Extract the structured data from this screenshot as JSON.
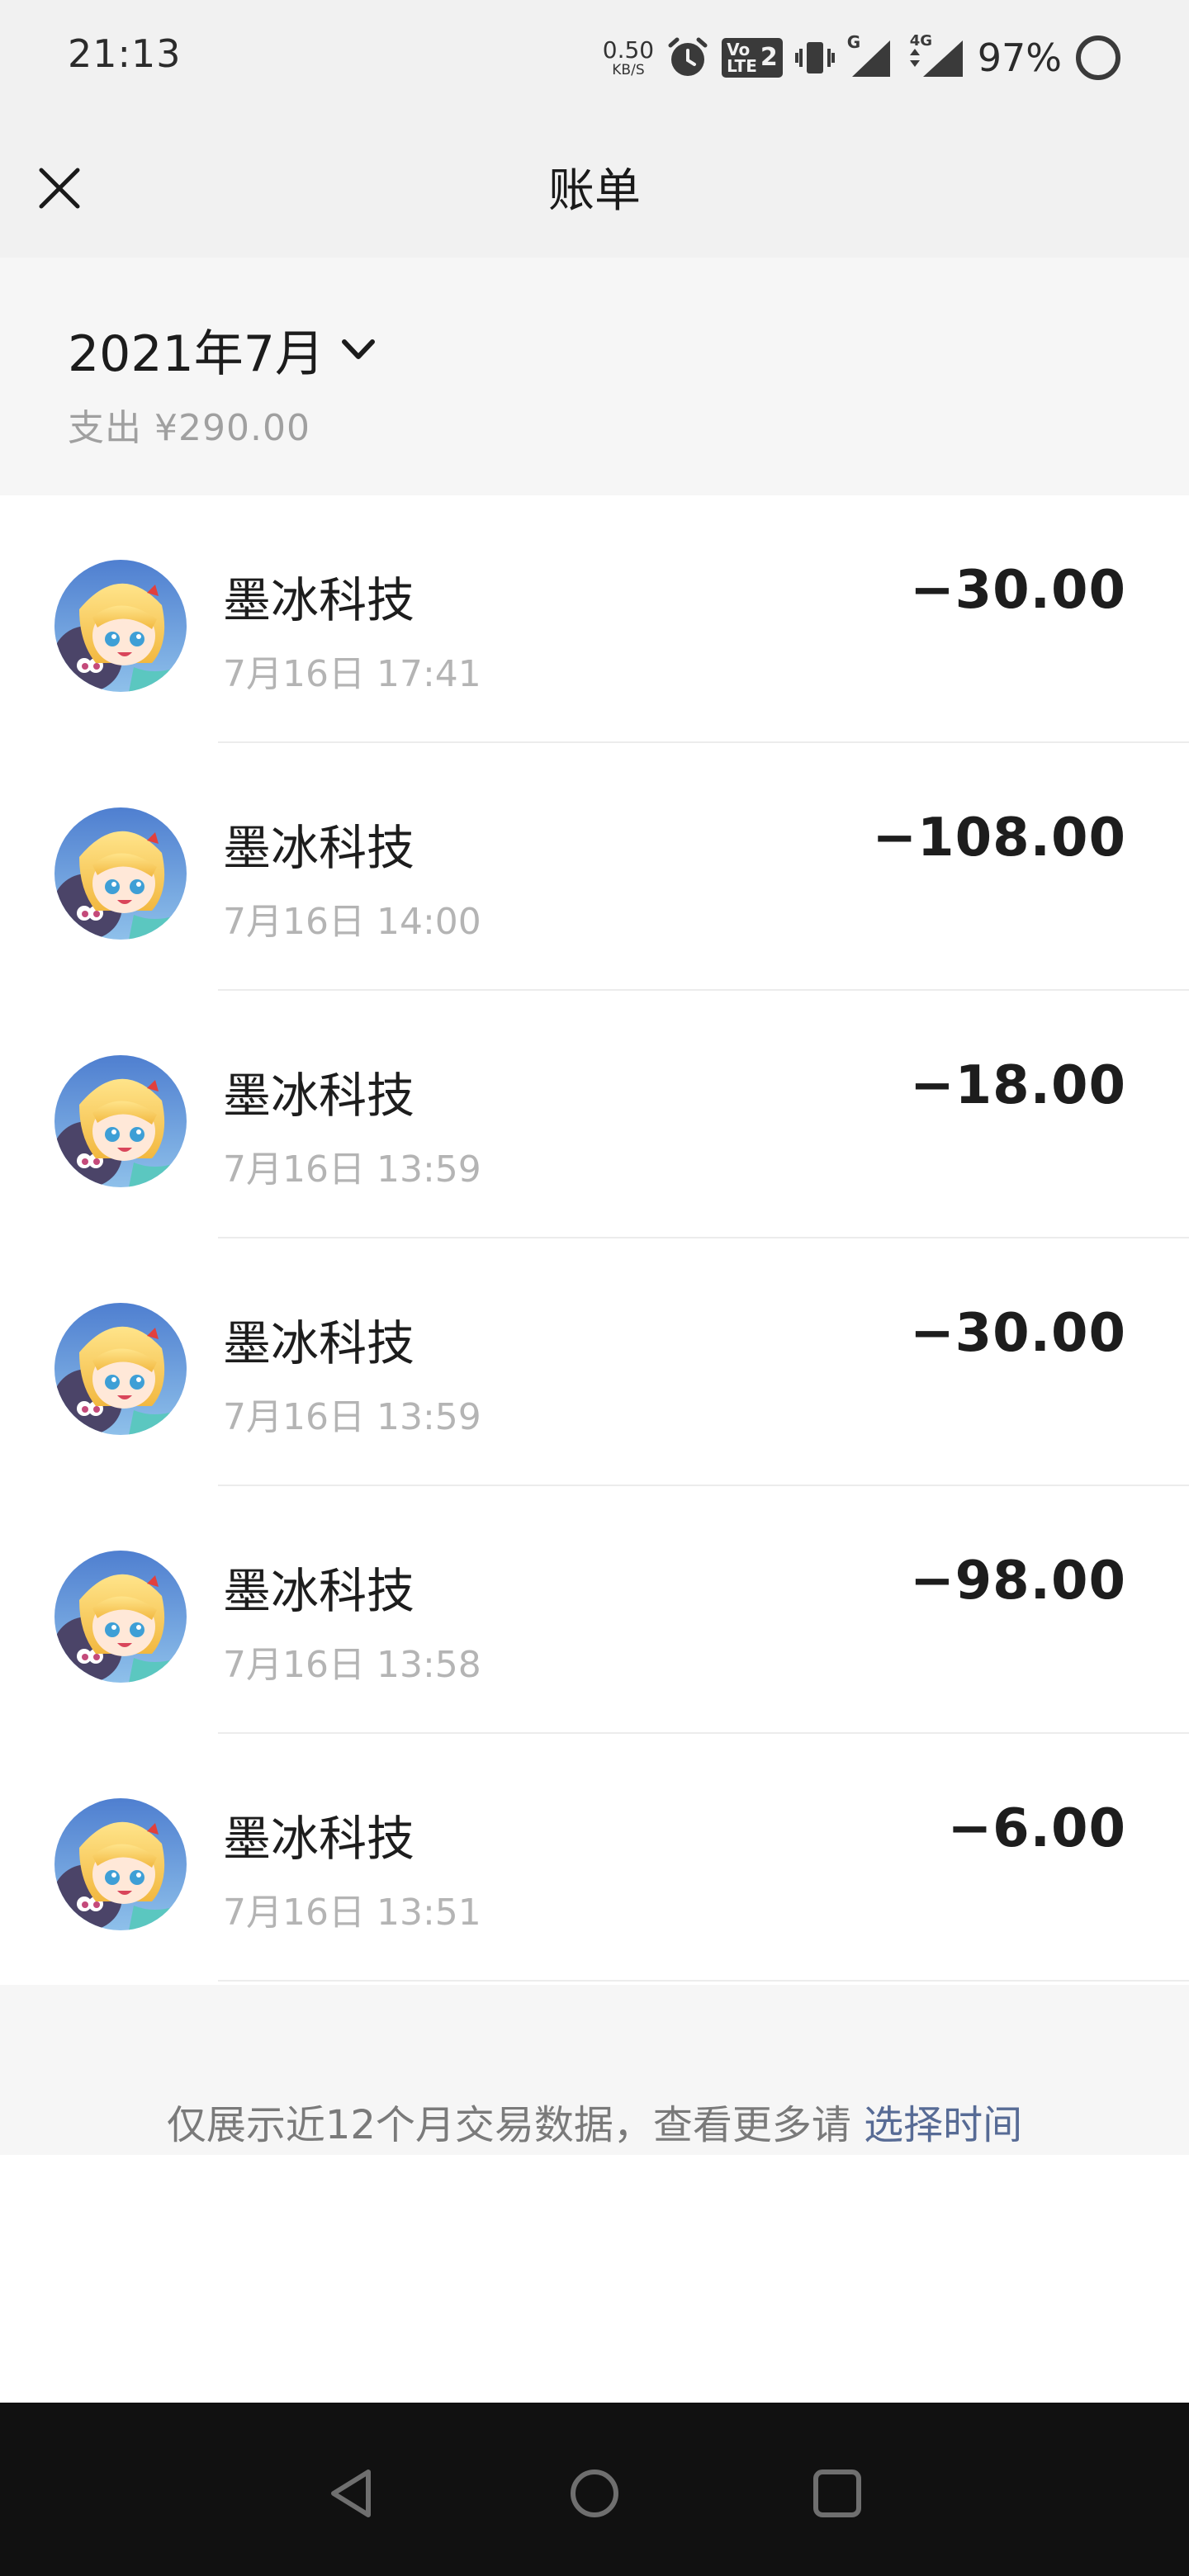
{
  "status_bar": {
    "time": "21:13",
    "net_speed": "0.50",
    "net_speed_unit": "KB/S",
    "volte_top": "Vo",
    "volte_bottom": "LTE",
    "volte_sim": "2",
    "signal1_label": "G",
    "signal2_label": "4G",
    "battery": "97%"
  },
  "header": {
    "title": "账单",
    "close_icon": "close-icon"
  },
  "summary": {
    "month": "2021年7月",
    "spend": "支出 ¥290.00"
  },
  "transactions": [
    {
      "name": "墨冰科技",
      "time": "7月16日 17:41",
      "amount": "−30.00"
    },
    {
      "name": "墨冰科技",
      "time": "7月16日 14:00",
      "amount": "−108.00"
    },
    {
      "name": "墨冰科技",
      "time": "7月16日 13:59",
      "amount": "−18.00"
    },
    {
      "name": "墨冰科技",
      "time": "7月16日 13:59",
      "amount": "−30.00"
    },
    {
      "name": "墨冰科技",
      "time": "7月16日 13:58",
      "amount": "−98.00"
    },
    {
      "name": "墨冰科技",
      "time": "7月16日 13:51",
      "amount": "−6.00"
    }
  ],
  "footer": {
    "note": "仅展示近12个月交易数据，查看更多请",
    "link": "选择时间"
  },
  "colors": {
    "link": "#576b95",
    "header_bg": "#f1f1f1",
    "navbar_bg": "#111111"
  }
}
